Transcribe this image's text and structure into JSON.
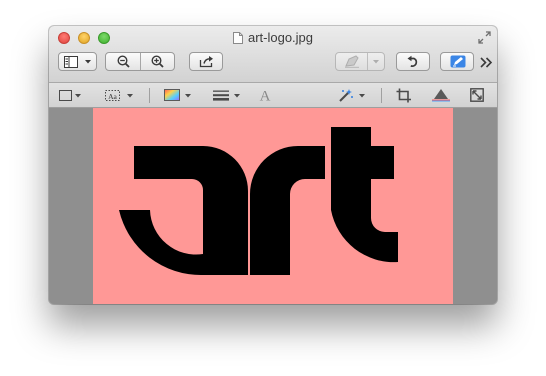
{
  "window": {
    "title": "art-logo.jpg",
    "file_icon": "document-icon"
  },
  "toolbar": {
    "items": [
      {
        "name": "view-menu",
        "icon": "sidebar-view-icon"
      },
      {
        "name": "zoom-out",
        "icon": "zoom-out-icon"
      },
      {
        "name": "zoom-in",
        "icon": "zoom-in-icon"
      },
      {
        "name": "share",
        "icon": "share-icon"
      },
      {
        "name": "highlight-menu",
        "icon": "highlighter-icon",
        "enabled": false
      },
      {
        "name": "rotate",
        "icon": "rotate-left-icon"
      },
      {
        "name": "markup-toggle",
        "icon": "pen-icon",
        "active": true
      },
      {
        "name": "overflow",
        "icon": "double-chevron-icon"
      }
    ]
  },
  "edit_toolbar": {
    "items": [
      {
        "name": "shapes",
        "icon": "rectangle-select-icon"
      },
      {
        "name": "text",
        "icon": "text-box-icon",
        "glyph": "Aa"
      },
      {
        "name": "color",
        "icon": "color-swatch-icon"
      },
      {
        "name": "line-style",
        "icon": "line-style-icon"
      },
      {
        "name": "font",
        "icon": "font-icon",
        "glyph": "A"
      },
      {
        "name": "instant-alpha",
        "icon": "magic-wand-icon"
      },
      {
        "name": "crop",
        "icon": "crop-icon"
      },
      {
        "name": "adjust-color",
        "icon": "prism-icon"
      },
      {
        "name": "adjust-size",
        "icon": "resize-icon"
      }
    ]
  },
  "colors": {
    "image_background": "#ff9896",
    "logo": "#000000",
    "content_background": "#8f8f8f",
    "accent_blue": "#2f7de1"
  },
  "image": {
    "logo_text": "art"
  }
}
